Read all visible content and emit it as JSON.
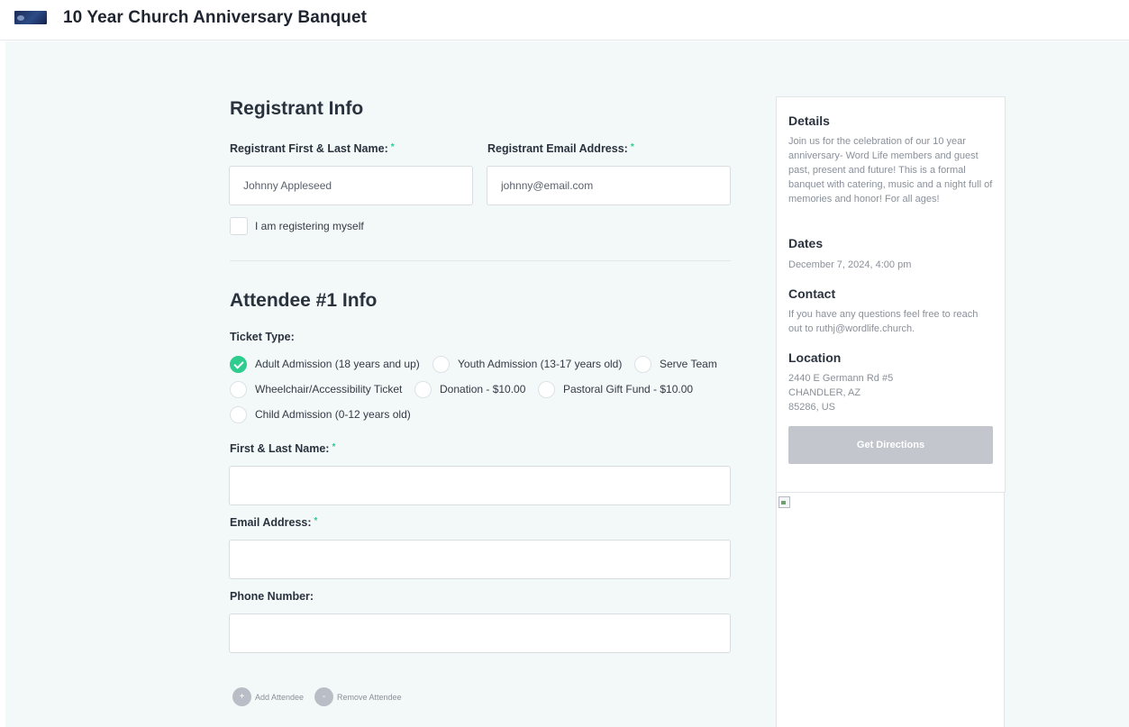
{
  "header": {
    "title": "10 Year Church Anniversary Banquet"
  },
  "registrant": {
    "heading": "Registrant Info",
    "name_label": "Registrant First & Last Name:",
    "name_placeholder": "Johnny Appleseed",
    "email_label": "Registrant Email Address:",
    "email_placeholder": "johnny@email.com",
    "required_mark": "*",
    "self_checkbox_label": "I am registering myself"
  },
  "attendee": {
    "heading": "Attendee #1 Info",
    "ticket_label": "Ticket Type:",
    "tickets": [
      {
        "label": "Adult Admission (18 years and up)",
        "checked": true
      },
      {
        "label": "Youth Admission (13-17 years old)",
        "checked": false
      },
      {
        "label": "Serve Team",
        "checked": false
      },
      {
        "label": "Wheelchair/Accessibility Ticket",
        "checked": false
      },
      {
        "label": "Donation - $10.00",
        "checked": false
      },
      {
        "label": "Pastoral Gift Fund - $10.00",
        "checked": false
      },
      {
        "label": "Child Admission (0-12 years old)",
        "checked": false
      }
    ],
    "name_label": "First & Last Name:",
    "email_label": "Email Address:",
    "phone_label": "Phone Number:",
    "add_icon": "+",
    "remove_icon": "-",
    "add_label": "Add Attendee",
    "remove_label": "Remove Attendee"
  },
  "sidebar": {
    "details_heading": "Details",
    "details_text": "Join us for the celebration of our 10 year anniversary- Word Life members and guest past, present and future! This is a formal banquet with catering, music and a night full of memories and honor! For all ages!",
    "dates_heading": "Dates",
    "dates_text": "December 7, 2024, 4:00 pm",
    "contact_heading": "Contact",
    "contact_text": "If you have any questions feel free to reach out to ruthj@wordlife.church.",
    "location_heading": "Location",
    "address_line1": "2440 E Germann Rd #5",
    "address_line2": "CHANDLER, AZ",
    "address_line3": "85286, US",
    "directions_label": "Get Directions"
  },
  "colors": {
    "accent": "#2ecc8f",
    "background": "#f3f8f8",
    "button_disabled": "#c3c7cd"
  }
}
